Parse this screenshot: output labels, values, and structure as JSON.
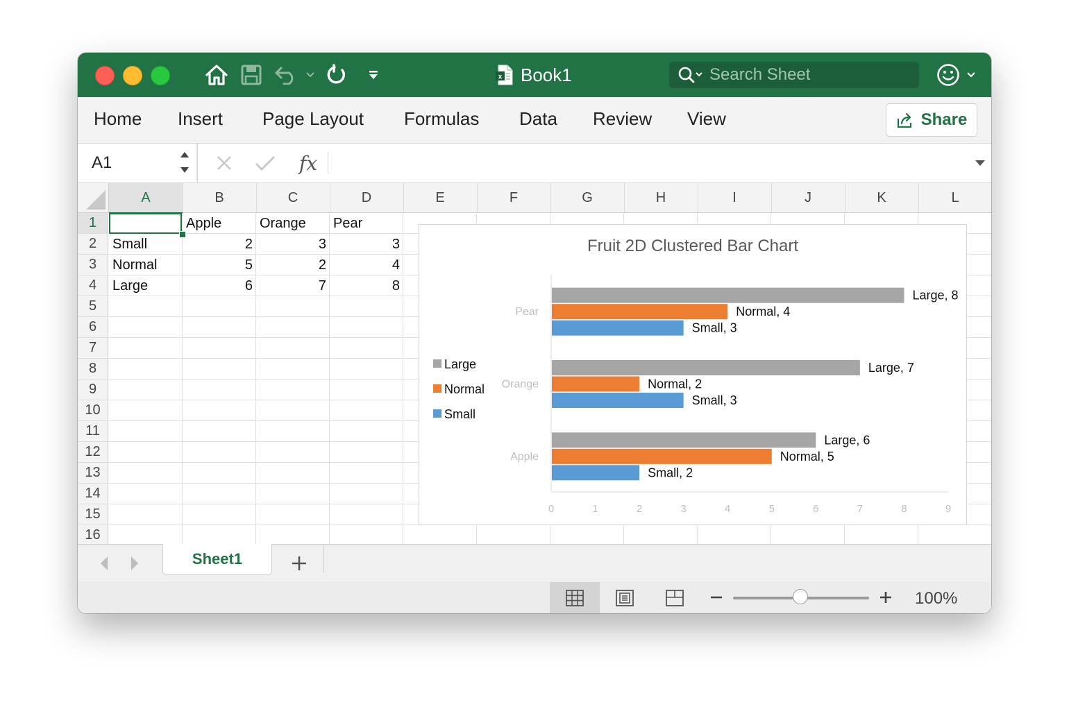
{
  "window": {
    "title": "Book1"
  },
  "search": {
    "placeholder": "Search Sheet"
  },
  "ribbon": {
    "tabs": [
      "Home",
      "Insert",
      "Page Layout",
      "Formulas",
      "Data",
      "Review",
      "View"
    ],
    "share_label": "Share"
  },
  "formula_bar": {
    "name_box": "A1",
    "formula": ""
  },
  "grid": {
    "columns": [
      "A",
      "B",
      "C",
      "D",
      "E",
      "F",
      "G",
      "H",
      "I",
      "J",
      "K",
      "L"
    ],
    "rows": [
      "1",
      "2",
      "3",
      "4",
      "5",
      "6",
      "7",
      "8",
      "9",
      "10",
      "11",
      "12",
      "13",
      "14",
      "15",
      "16"
    ],
    "cells": [
      {
        "col": 1,
        "row": 0,
        "value": "Apple",
        "align": "left"
      },
      {
        "col": 2,
        "row": 0,
        "value": "Orange",
        "align": "left"
      },
      {
        "col": 3,
        "row": 0,
        "value": "Pear",
        "align": "left"
      },
      {
        "col": 0,
        "row": 1,
        "value": "Small",
        "align": "left"
      },
      {
        "col": 1,
        "row": 1,
        "value": "2",
        "align": "right"
      },
      {
        "col": 2,
        "row": 1,
        "value": "3",
        "align": "right"
      },
      {
        "col": 3,
        "row": 1,
        "value": "3",
        "align": "right"
      },
      {
        "col": 0,
        "row": 2,
        "value": "Normal",
        "align": "left"
      },
      {
        "col": 1,
        "row": 2,
        "value": "5",
        "align": "right"
      },
      {
        "col": 2,
        "row": 2,
        "value": "2",
        "align": "right"
      },
      {
        "col": 3,
        "row": 2,
        "value": "4",
        "align": "right"
      },
      {
        "col": 0,
        "row": 3,
        "value": "Large",
        "align": "left"
      },
      {
        "col": 1,
        "row": 3,
        "value": "6",
        "align": "right"
      },
      {
        "col": 2,
        "row": 3,
        "value": "7",
        "align": "right"
      },
      {
        "col": 3,
        "row": 3,
        "value": "8",
        "align": "right"
      }
    ]
  },
  "chart_data": {
    "type": "bar",
    "orientation": "horizontal",
    "title": "Fruit 2D Clustered Bar Chart",
    "categories": [
      "Apple",
      "Orange",
      "Pear"
    ],
    "series": [
      {
        "name": "Small",
        "values": [
          2,
          3,
          3
        ],
        "color": "#5b9bd5"
      },
      {
        "name": "Normal",
        "values": [
          5,
          2,
          4
        ],
        "color": "#ed7d31"
      },
      {
        "name": "Large",
        "values": [
          6,
          7,
          8
        ],
        "color": "#a5a5a5"
      }
    ],
    "xlim": [
      0,
      9
    ],
    "xticks": [
      "0",
      "1",
      "2",
      "3",
      "4",
      "5",
      "6",
      "7",
      "8",
      "9"
    ],
    "legend": {
      "position": "left",
      "order": [
        "Large",
        "Normal",
        "Small"
      ]
    },
    "data_labels": true,
    "grid": false
  },
  "sheets": {
    "tabs": [
      "Sheet1"
    ],
    "active": "Sheet1"
  },
  "status": {
    "zoom": "100%",
    "zoom_level": 0.5
  },
  "colors": {
    "accent": "#217346"
  }
}
